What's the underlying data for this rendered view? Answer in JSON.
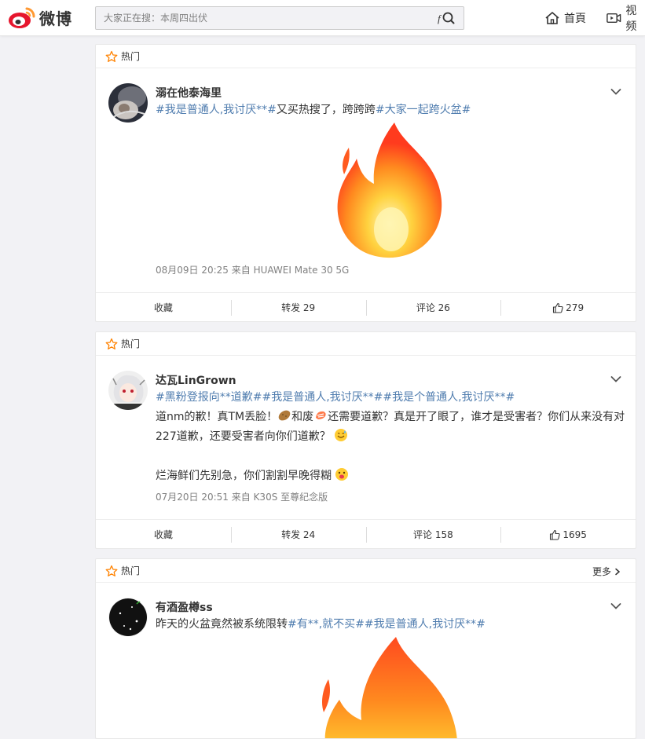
{
  "header": {
    "logo_text": "微博",
    "search_placeholder": "大家正在搜：本周四出伏",
    "nav": [
      {
        "label": "首頁",
        "icon": "home-icon"
      },
      {
        "label": "视频",
        "icon": "video-icon"
      }
    ]
  },
  "posts": [
    {
      "section_label": "热门",
      "username": "溺在他泰海里",
      "text_parts": [
        {
          "text": "#我是普通人,我讨厌**#",
          "type": "topic"
        },
        {
          "text": "又买热搜了，跨跨跨",
          "type": "plain"
        },
        {
          "text": "#大家一起跨火盆#",
          "type": "topic"
        }
      ],
      "meta": "08月09日 20:25  来自 HUAWEI Mate 30 5G",
      "actions": {
        "collect": "收藏",
        "repost": "转发 29",
        "comment": "评论 26",
        "like": "279"
      }
    },
    {
      "section_label": "热门",
      "username": "达瓦LinGrown",
      "text_parts": [
        {
          "text": "#黑粉登报向**道歉##我是普通人,我讨厌**##我是个普通人,我讨厌**#",
          "type": "topic"
        }
      ],
      "body_line1": "道nm的歉！真TM丢脸！",
      "body_line1b": "和废",
      "body_line1c": "还需要道歉？真是开了眼了，谁才是受害者？你们从来没有对",
      "body_line2": "227道歉，还要受害者向你们道歉？",
      "body_line3": "烂海鲜们先别急，你们割割早晚得糊",
      "meta": "07月20日 20:51  来自 K30S 至尊纪念版",
      "actions": {
        "collect": "收藏",
        "repost": "转发 24",
        "comment": "评论 158",
        "like": "1695"
      }
    },
    {
      "section_label": "热门",
      "more_label": "更多",
      "username": "有酒盈樽ss",
      "text_parts": [
        {
          "text": "昨天的火盆竟然被系统限转",
          "type": "plain"
        },
        {
          "text": "#有**,就不买##我是普通人,我讨厌**#",
          "type": "topic"
        }
      ]
    }
  ],
  "colors": {
    "topic": "#507daf",
    "accent": "#ff8200",
    "background": "#f2f2f5"
  }
}
